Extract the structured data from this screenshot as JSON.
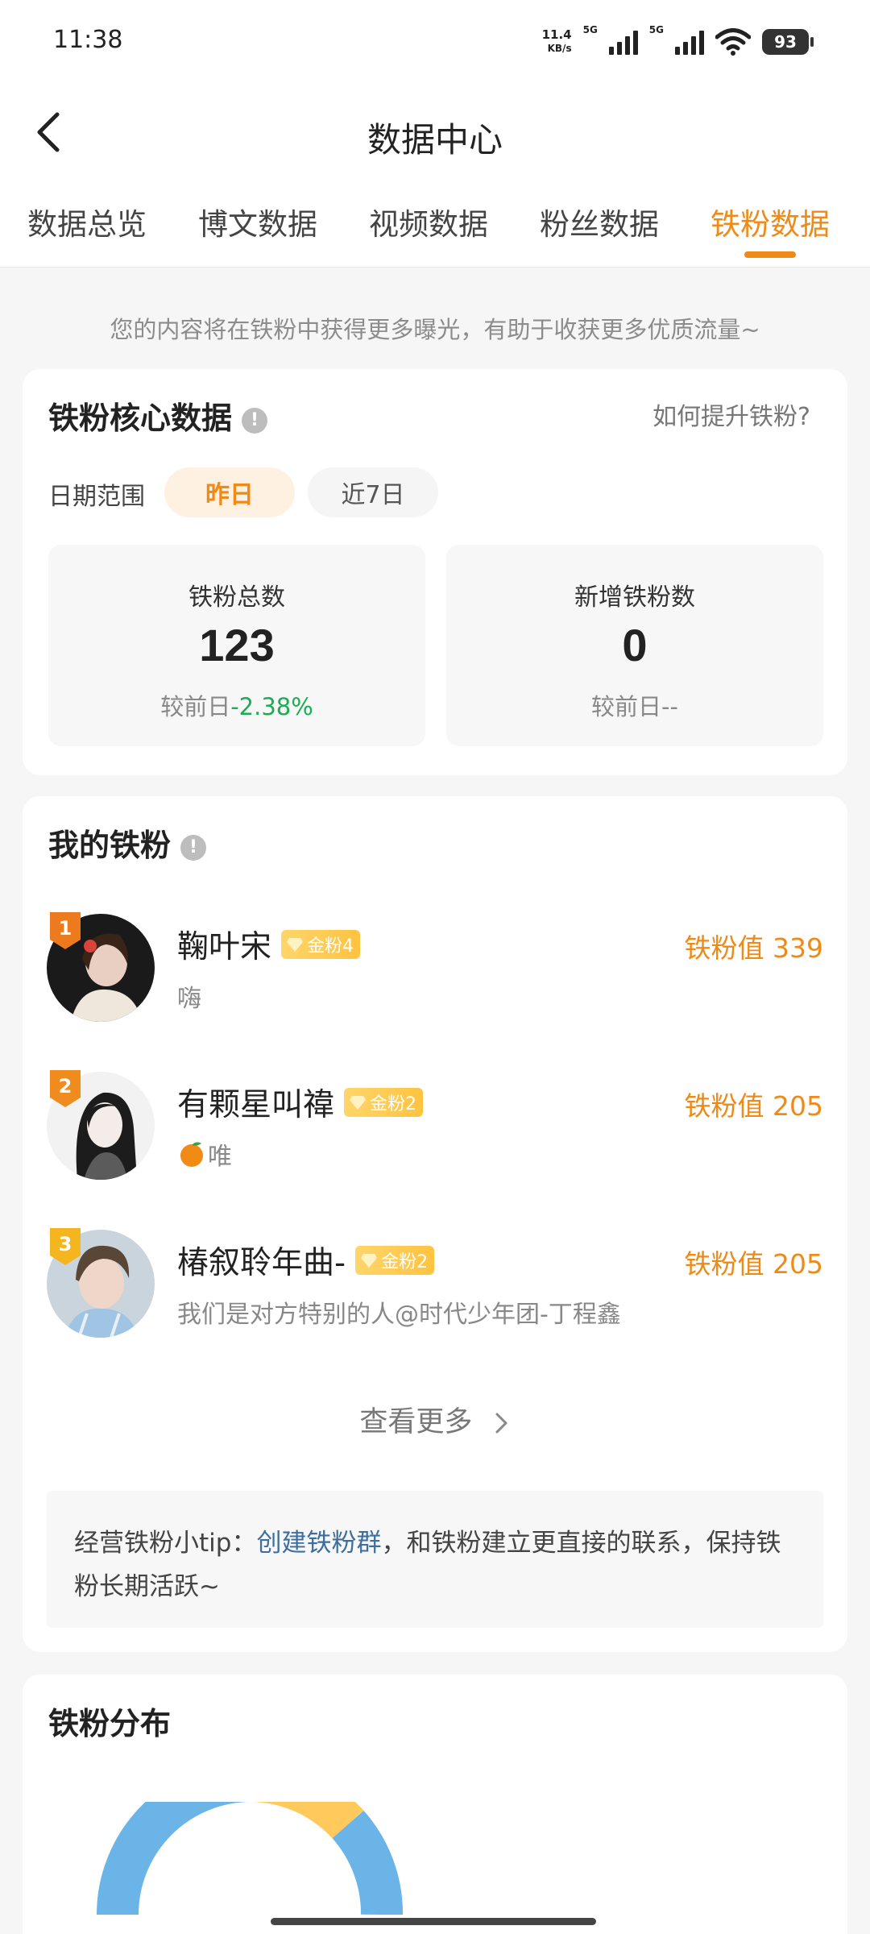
{
  "status_bar": {
    "time": "11:38",
    "net_speed_value": "11.4",
    "net_speed_unit": "KB/s",
    "net_type_1": "5G",
    "net_type_2": "5G",
    "battery": "93"
  },
  "nav": {
    "title": "数据中心"
  },
  "tabs": [
    {
      "label": "数据总览"
    },
    {
      "label": "博文数据"
    },
    {
      "label": "视频数据"
    },
    {
      "label": "粉丝数据"
    },
    {
      "label": "铁粉数据",
      "active": true
    }
  ],
  "intro_text": "您的内容将在铁粉中获得更多曝光，有助于收获更多优质流量~",
  "core": {
    "title": "铁粉核心数据",
    "help_link": "如何提升铁粉?",
    "date_label": "日期范围",
    "date_options": [
      "昨日",
      "近7日"
    ],
    "selected_date": "昨日",
    "stats": [
      {
        "label": "铁粉总数",
        "value": "123",
        "compare_label": "较前日",
        "compare_value": "-2.38%"
      },
      {
        "label": "新增铁粉数",
        "value": "0",
        "compare_label": "较前日",
        "compare_value": "--"
      }
    ]
  },
  "my_fans": {
    "title": "我的铁粉",
    "fans": [
      {
        "rank": "1",
        "name": "鞠叶宋",
        "level": "金粉4",
        "sign": "嗨",
        "score_label": "铁粉值",
        "score": "339"
      },
      {
        "rank": "2",
        "name": "有颗星叫禕",
        "level": "金粉2",
        "sign": "唯",
        "score_label": "铁粉值",
        "score": "205"
      },
      {
        "rank": "3",
        "name": "椿叙聆年曲-",
        "level": "金粉2",
        "sign": "我们是对方特别的人@时代少年团-丁程鑫",
        "score_label": "铁粉值",
        "score": "205"
      }
    ],
    "more_label": "查看更多",
    "tip_prefix": "经营铁粉小tip：",
    "tip_link": "创建铁粉群",
    "tip_suffix": "，和铁粉建立更直接的联系，保持铁粉长期活跃~"
  },
  "distribution": {
    "title": "铁粉分布"
  },
  "colors": {
    "accent": "#ef8a17",
    "green": "#1aad54",
    "link": "#3d6e9f",
    "donut_blue": "#6ab4e8",
    "donut_yellow": "#ffc95c"
  }
}
